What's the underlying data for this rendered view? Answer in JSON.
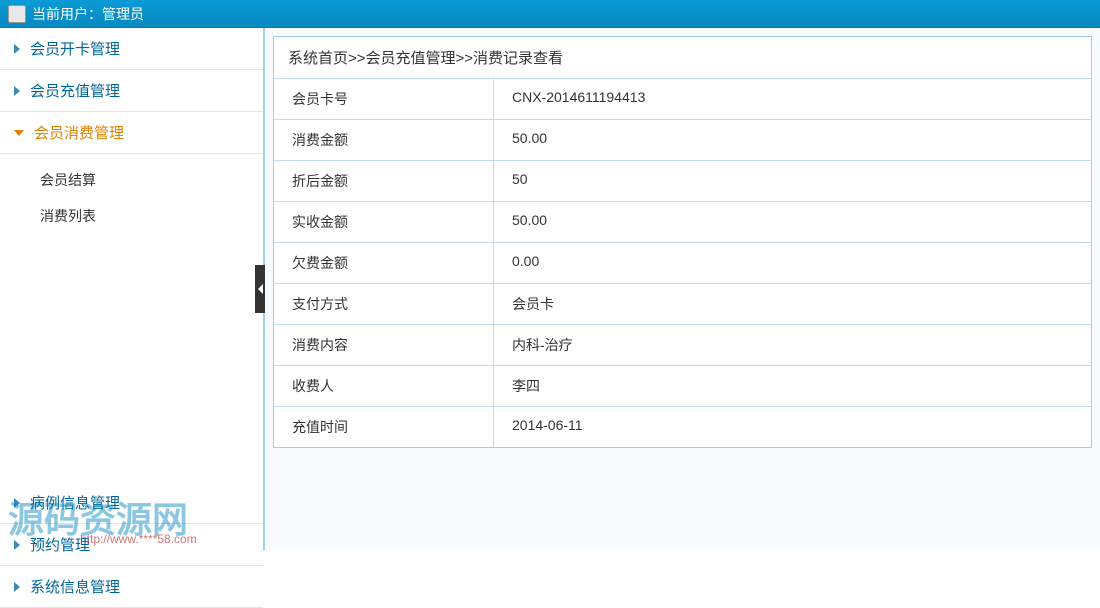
{
  "header": {
    "user_label": "当前用户：管理员"
  },
  "sidebar": {
    "items": [
      {
        "label": "会员开卡管理",
        "active": false
      },
      {
        "label": "会员充值管理",
        "active": false
      },
      {
        "label": "会员消费管理",
        "active": true
      },
      {
        "label": "病例信息管理",
        "active": false
      },
      {
        "label": "预约管理",
        "active": false
      },
      {
        "label": "系统信息管理",
        "active": false
      }
    ],
    "sub_items": [
      {
        "label": "会员结算"
      },
      {
        "label": "消费列表"
      }
    ]
  },
  "breadcrumb": {
    "text": "系统首页>>会员充值管理>>消费记录查看"
  },
  "detail": {
    "rows": [
      {
        "label": "会员卡号",
        "value": "CNX-2014611194413"
      },
      {
        "label": "消费金额",
        "value": "50.00"
      },
      {
        "label": "折后金额",
        "value": "50"
      },
      {
        "label": "实收金额",
        "value": "50.00"
      },
      {
        "label": "欠费金额",
        "value": "0.00"
      },
      {
        "label": "支付方式",
        "value": "会员卡"
      },
      {
        "label": "消费内容",
        "value": "内科-治疗"
      },
      {
        "label": "收费人",
        "value": "李四"
      },
      {
        "label": "充值时间",
        "value": "2014-06-11"
      }
    ]
  },
  "watermark": {
    "main": "源码资源网",
    "sub": "http://www.****58.com"
  }
}
